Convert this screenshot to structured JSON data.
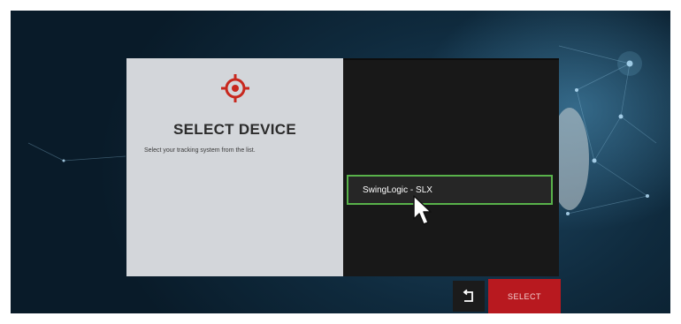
{
  "device_panel": {
    "icon": "target-crosshair-icon",
    "title": "SELECT DEVICE",
    "subtitle": "Select your tracking system from the list."
  },
  "device_list": {
    "items": [
      {
        "label": "",
        "selected": false
      },
      {
        "label": "",
        "selected": false
      },
      {
        "label": "",
        "selected": false
      },
      {
        "label": "",
        "selected": false
      },
      {
        "label": "",
        "selected": false
      },
      {
        "label": "SwingLogic - SLX",
        "selected": true
      },
      {
        "label": "",
        "selected": false
      },
      {
        "label": "",
        "selected": false
      },
      {
        "label": "",
        "selected": false
      }
    ]
  },
  "actions": {
    "back_icon": "return-arrow-icon",
    "select_label": "SELECT"
  },
  "colors": {
    "accent_red": "#b8191f",
    "selection_green": "#58b24a",
    "panel_light": "#d3d6da",
    "panel_dark": "#181818"
  }
}
